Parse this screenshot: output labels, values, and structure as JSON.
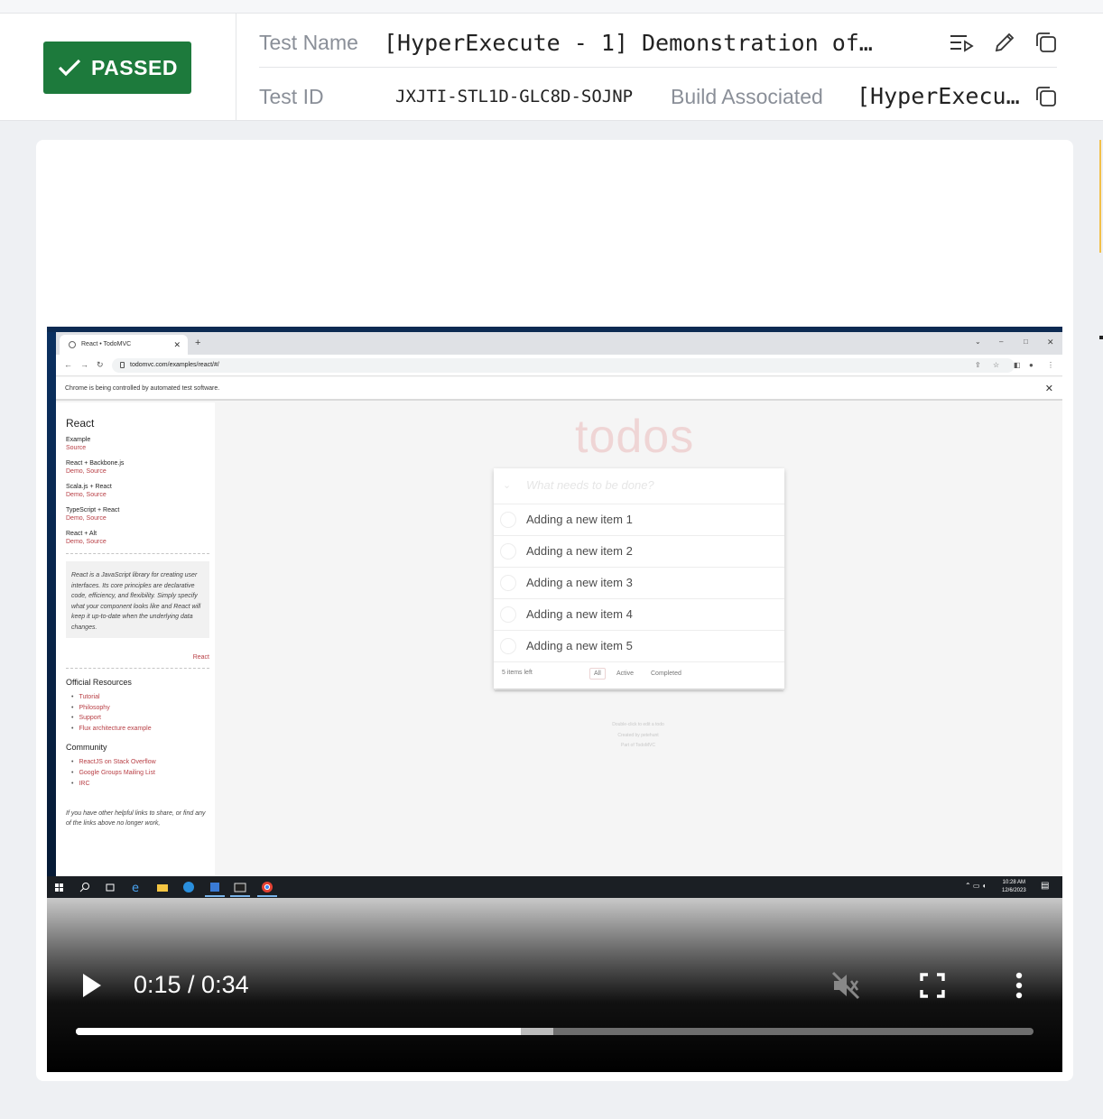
{
  "header": {
    "status": "PASSED",
    "test_name_label": "Test Name",
    "test_name_value": "[HyperExecute - 1] Demonstration of …",
    "test_id_label": "Test ID",
    "test_id_value": "JXJTI-STL1D-GLC8D-SOJNP",
    "build_label": "Build Associated",
    "build_value": "[HyperExecut…"
  },
  "browser": {
    "tab_title": "React • TodoMVC",
    "url": "todomvc.com/examples/react/#/",
    "automation_notice": "Chrome is being controlled by automated test software."
  },
  "sidebar": {
    "title": "React",
    "examples": [
      {
        "name": "Example",
        "links": "Source"
      },
      {
        "name": "React + Backbone.js",
        "links": "Demo, Source"
      },
      {
        "name": "Scala.js + React",
        "links": "Demo, Source"
      },
      {
        "name": "TypeScript + React",
        "links": "Demo, Source"
      },
      {
        "name": "React + Alt",
        "links": "Demo, Source"
      }
    ],
    "quote": "React is a JavaScript library for creating user interfaces. Its core principles are declarative code, efficiency, and flexibility. Simply specify what your component looks like and React will keep it up-to-date when the underlying data changes.",
    "quote_source": "React",
    "official_title": "Official Resources",
    "official_links": [
      "Tutorial",
      "Philosophy",
      "Support",
      "Flux architecture example"
    ],
    "community_title": "Community",
    "community_links": [
      "ReactJS on Stack Overflow",
      "Google Groups Mailing List",
      "IRC"
    ],
    "footer_text": "If you have other helpful links to share, or find any of the links above no longer work,"
  },
  "todo": {
    "title": "todos",
    "placeholder": "What needs to be done?",
    "items": [
      "Adding a new item 1",
      "Adding a new item 2",
      "Adding a new item 3",
      "Adding a new item 4",
      "Adding a new item 5"
    ],
    "items_left": "5 items left",
    "filters": [
      "All",
      "Active",
      "Completed"
    ],
    "info": [
      "Double-click to edit a todo",
      "Created by petehunt",
      "Part of TodoMVC"
    ]
  },
  "taskbar": {
    "time": "10:28 AM",
    "date": "12/6/2023"
  },
  "video": {
    "time_display": "0:15 / 0:34",
    "played_fraction": 0.465,
    "buffered_fraction": 0.499
  },
  "colors": {
    "passed": "#1d7a3c",
    "todo_accent": "#b83f45",
    "title_pink": "#efd5d5"
  }
}
